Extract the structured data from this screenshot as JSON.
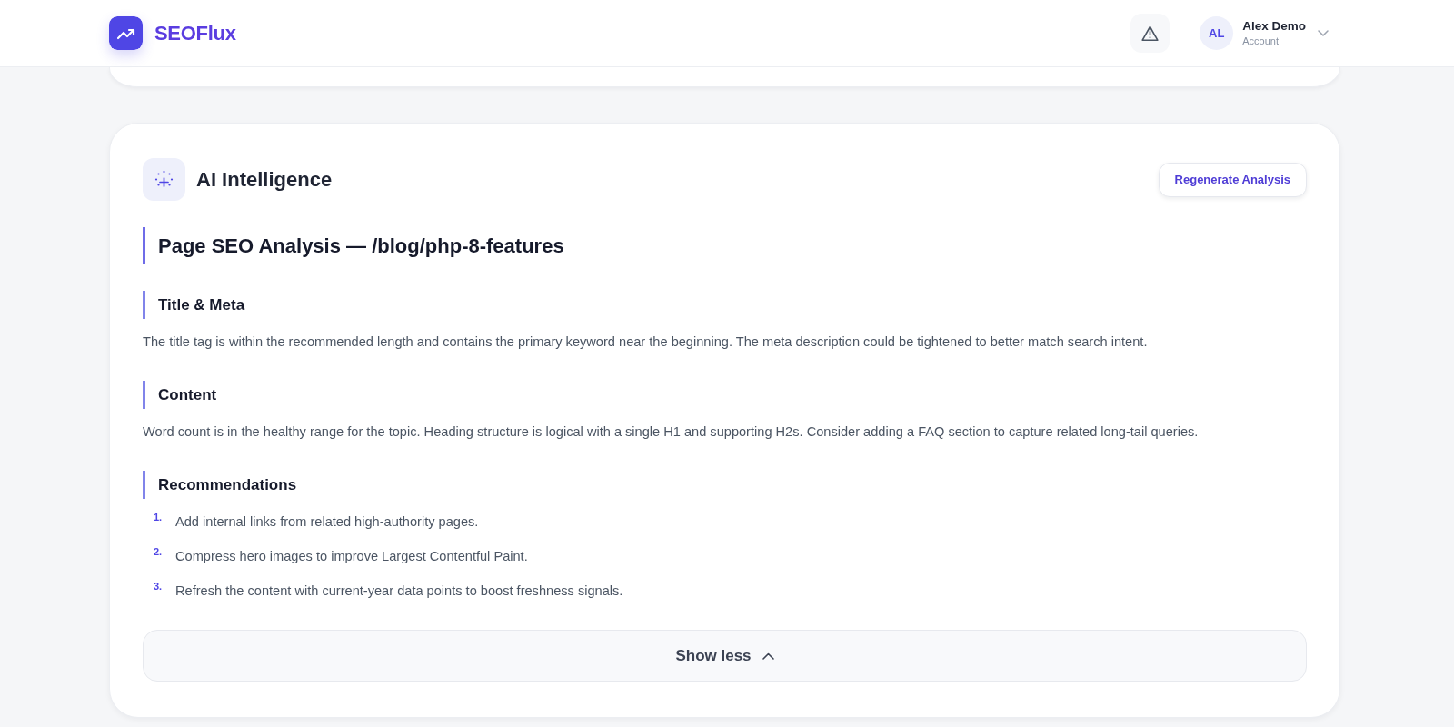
{
  "header": {
    "brand": "SEOFlux",
    "user": {
      "initials": "AL",
      "name": "Alex Demo",
      "role": "Account"
    }
  },
  "ai_card": {
    "title": "AI Intelligence",
    "action": "Regenerate Analysis",
    "heading": "Page SEO Analysis — /blog/php-8-features",
    "sections": [
      {
        "kind": "paragraph",
        "heading": "Title & Meta",
        "text": "The title tag is within the recommended length and contains the primary keyword near the beginning. The meta description could be tightened to better match search intent."
      },
      {
        "kind": "paragraph",
        "heading": "Content",
        "text": "Word count is in the healthy range for the topic. Heading structure is logical with a single H1 and supporting H2s. Consider adding a FAQ section to capture related long-tail queries."
      },
      {
        "kind": "list",
        "heading": "Recommendations",
        "items": [
          {
            "number": "1.",
            "text": "Add internal links from related high-authority pages."
          },
          {
            "number": "2.",
            "text": "Compress hero images to improve Largest Contentful Paint."
          },
          {
            "number": "3.",
            "text": "Refresh the content with current-year data points to boost freshness signals."
          }
        ]
      }
    ],
    "toggle": {
      "label": "Show less",
      "expanded": true
    }
  }
}
